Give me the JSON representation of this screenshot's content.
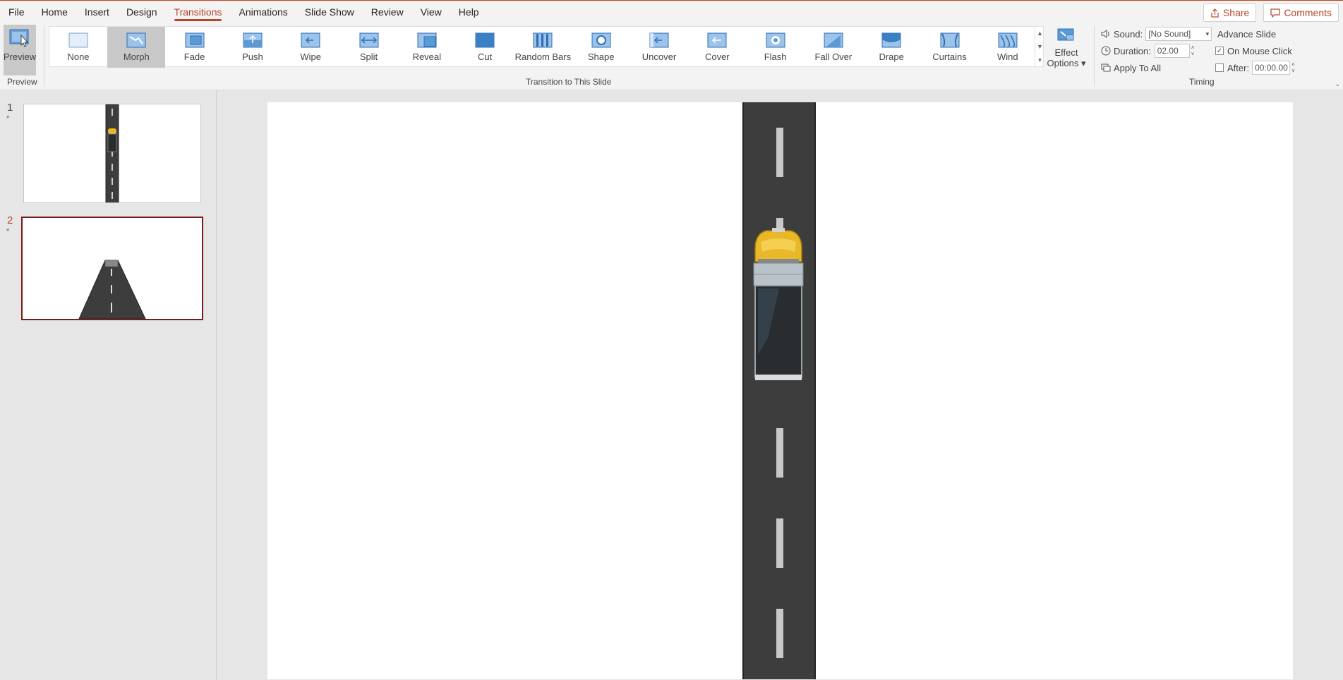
{
  "menu": {
    "items": [
      "File",
      "Home",
      "Insert",
      "Design",
      "Transitions",
      "Animations",
      "Slide Show",
      "Review",
      "View",
      "Help"
    ],
    "active": "Transitions",
    "share_label": "Share",
    "comments_label": "Comments"
  },
  "ribbon": {
    "preview_label": "Preview",
    "preview_group": "Preview",
    "transitions_group": "Transition to This Slide",
    "transitions": [
      "None",
      "Morph",
      "Fade",
      "Push",
      "Wipe",
      "Split",
      "Reveal",
      "Cut",
      "Random Bars",
      "Shape",
      "Uncover",
      "Cover",
      "Flash",
      "Fall Over",
      "Drape",
      "Curtains",
      "Wind"
    ],
    "selected_transition": "Morph",
    "effect_options_line1": "Effect",
    "effect_options_line2": "Options",
    "timing": {
      "group": "Timing",
      "sound_label": "Sound:",
      "sound_value": "[No Sound]",
      "duration_label": "Duration:",
      "duration_value": "02.00",
      "apply_all": "Apply To All",
      "advance_label": "Advance Slide",
      "on_click_label": "On Mouse Click",
      "on_click_checked": true,
      "after_label": "After:",
      "after_checked": false,
      "after_value": "00:00.00"
    }
  },
  "thumbnails": {
    "slides": [
      {
        "number": "1",
        "star": "*"
      },
      {
        "number": "2",
        "star": "*"
      }
    ],
    "selected": "2"
  },
  "colors": {
    "accent": "#b7472a",
    "road": "#3d3d3d",
    "lane_marking": "#c8c8c8",
    "truck_cab": "#e8b828",
    "truck_trailer": "#2a2d30"
  }
}
